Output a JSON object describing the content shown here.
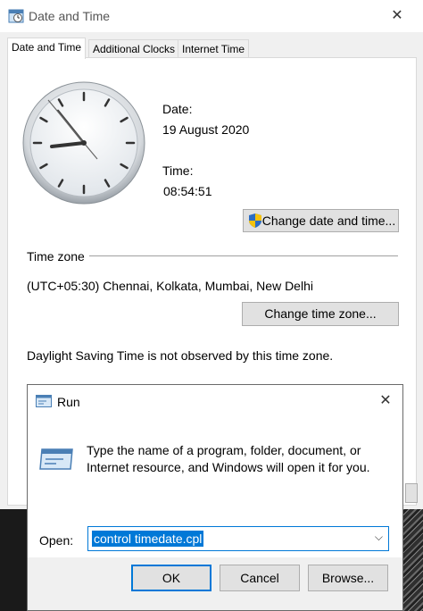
{
  "datetime_window": {
    "title": "Date and Time",
    "tabs": [
      {
        "label": "Date and Time"
      },
      {
        "label": "Additional Clocks"
      },
      {
        "label": "Internet Time"
      }
    ],
    "date_label": "Date:",
    "date_value": "19 August 2020",
    "time_label": "Time:",
    "time_value": "08:54:51",
    "change_datetime_button": "Change date and time...",
    "timezone_heading": "Time zone",
    "timezone_value": "(UTC+05:30) Chennai, Kolkata, Mumbai, New Delhi",
    "change_timezone_button": "Change time zone...",
    "dst_note": "Daylight Saving Time is not observed by this time zone."
  },
  "run_dialog": {
    "title": "Run",
    "description": "Type the name of a program, folder, document, or Internet resource, and Windows will open it for you.",
    "open_label": "Open:",
    "open_value": "control timedate.cpl",
    "ok_button": "OK",
    "cancel_button": "Cancel",
    "browse_button": "Browse..."
  },
  "colors": {
    "accent": "#0078d7",
    "window_bg": "#f0f0f0",
    "button_bg": "#e1e1e1"
  },
  "icons": {
    "datetime_app": "calendar-clock-icon",
    "close": "close-icon",
    "shield": "uac-shield-icon",
    "run_app": "run-icon",
    "dropdown": "chevron-down-icon"
  }
}
